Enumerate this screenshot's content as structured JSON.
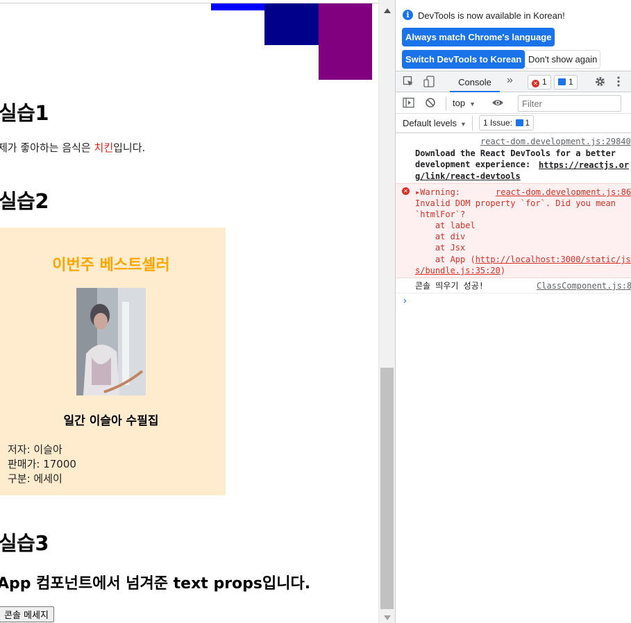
{
  "practice1": {
    "heading": "실습1",
    "food_prefix": "제가 좋아하는 음식은 ",
    "food_highlight": "치킨",
    "food_suffix": "입니다."
  },
  "practice2": {
    "heading": "실습2",
    "banner": "이번주 베스트셀러",
    "book_title": "일간 이슬아 수필집",
    "author": "저자: 이슬아",
    "price": "판매가: 17000",
    "category": "구분: 에세이"
  },
  "practice3": {
    "heading": "실습3",
    "props_text": "App 컴포넌트에서 넘겨준 text props입니다.",
    "button_label": "콘솔 메세지"
  },
  "devtools": {
    "info_message": "DevTools is now available in Korean!",
    "btn_match_language": "Always match Chrome's language",
    "btn_switch_korean": "Switch DevTools to Korean",
    "btn_dont_show": "Don't show again",
    "tab_console": "Console",
    "more_tabs": "»",
    "error_count": "1",
    "message_count": "1",
    "context": "top",
    "filter_placeholder": "Filter",
    "default_levels": "Default levels",
    "issues_label": "1 Issue:",
    "issues_count": "1",
    "logs": {
      "log1_source": "react-dom.development.js:29840",
      "log1_text": "Download the React DevTools for a better development experience: ",
      "log1_link1": "https://reactjs.or",
      "log1_link2": "g/link/react-devtools",
      "warn_prefix": "▸Warning:",
      "warn_source": "react-dom.development.js:86",
      "warn_line1": "Invalid DOM property `for`. Did you mean",
      "warn_line2": "`htmlFor`?",
      "warn_at1": "    at label",
      "warn_at2": "    at div",
      "warn_at3": "    at Jsx",
      "warn_at4": "    at App (",
      "warn_link1": "http://localhost:3000/static/js",
      "warn_link2": "s/bundle.js:35:20",
      "warn_tail": ")",
      "log3_text": "콘솔 띄우기 성공!",
      "log3_source": "ClassComponent.js:8"
    }
  }
}
